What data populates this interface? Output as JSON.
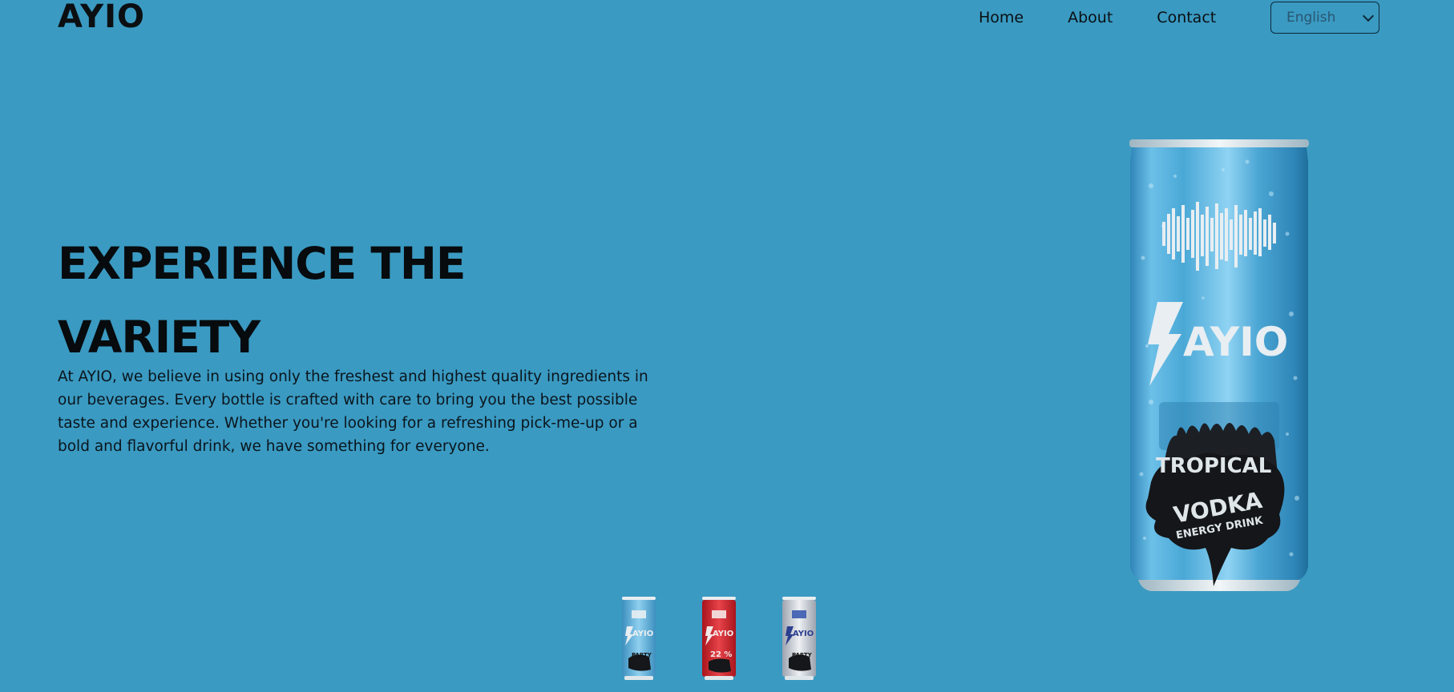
{
  "header": {
    "logo": "AYIO",
    "nav": [
      {
        "label": "Home"
      },
      {
        "label": "About"
      },
      {
        "label": "Contact"
      }
    ],
    "language": {
      "selected": "English"
    }
  },
  "hero": {
    "title_line1": "EXPERIENCE THE",
    "title_line2": "VARIETY",
    "description": "At AYIO, we believe in using only the freshest and highest quality ingredients in our beverages. Every bottle is crafted with care to bring you the best possible taste and experience. Whether you're looking for a refreshing pick-me-up or a bold and flavorful drink, we have something for everyone."
  },
  "featured_can": {
    "brand": "AYIO",
    "flavor": "TROPICAL",
    "type": "VODKA",
    "sub": "ENERGY DRINK",
    "color": "#4aa8d6"
  },
  "thumbnails": [
    {
      "brand": "AYIO",
      "label": "PARTY",
      "color": "#5fb4dc"
    },
    {
      "brand": "AYIO",
      "label": "22 %",
      "color": "#d6222a"
    },
    {
      "brand": "AYIO",
      "label": "PARTY",
      "color": "#c8ccd6"
    }
  ],
  "colors": {
    "background": "#3a9ac2",
    "text": "#0a0f14"
  }
}
